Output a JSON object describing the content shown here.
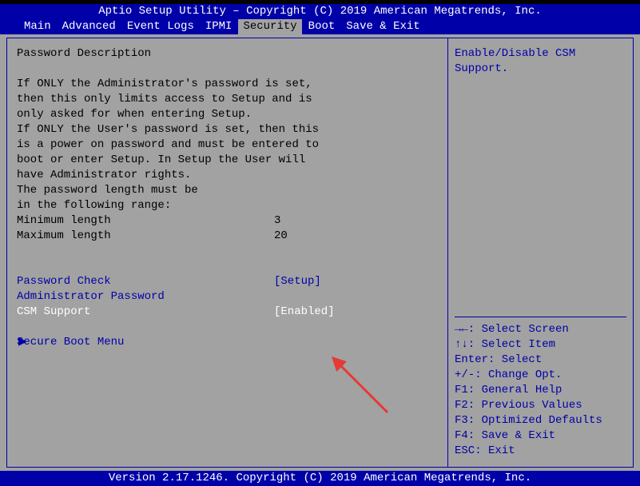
{
  "header": {
    "title": "Aptio Setup Utility – Copyright (C) 2019 American Megatrends, Inc."
  },
  "menu": {
    "items": [
      "Main",
      "Advanced",
      "Event Logs",
      "IPMI",
      "Security",
      "Boot",
      "Save & Exit"
    ],
    "active_index": 4
  },
  "left": {
    "section_title": "Password Description",
    "desc1": "If ONLY the Administrator's password is set,",
    "desc2": "then this only limits access to Setup and is",
    "desc3": "only asked for when entering Setup.",
    "desc4": "If ONLY the User's password is set, then this",
    "desc5": "is a power on password and must be entered to",
    "desc6": "boot or enter Setup. In Setup the User will",
    "desc7": "have Administrator rights.",
    "desc8": "The password length must be",
    "desc9": "in the following range:",
    "min_label": "Minimum length",
    "min_value": "3",
    "max_label": "Maximum length",
    "max_value": "20",
    "password_check_label": "Password Check",
    "password_check_value": "[Setup]",
    "admin_password_label": "Administrator Password",
    "csm_label": "CSM Support",
    "csm_value": "[Enabled]",
    "secure_boot_label": "Secure Boot Menu"
  },
  "right": {
    "help": "Enable/Disable CSM Support.",
    "keys": {
      "k0": "→←: Select Screen",
      "k1": "↑↓: Select Item",
      "k2": "Enter: Select",
      "k3": "+/-: Change Opt.",
      "k4": "F1: General Help",
      "k5": "F2: Previous Values",
      "k6": "F3: Optimized Defaults",
      "k7": "F4: Save & Exit",
      "k8": "ESC: Exit"
    }
  },
  "footer": {
    "text": "Version 2.17.1246. Copyright (C) 2019 American Megatrends, Inc."
  }
}
